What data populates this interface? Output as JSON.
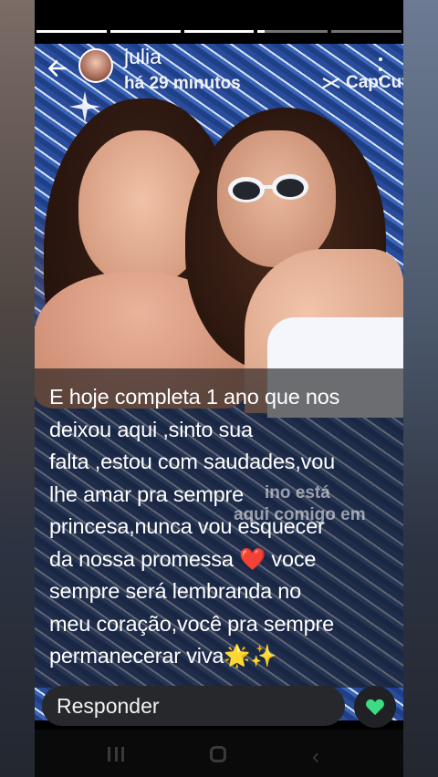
{
  "header": {
    "username": "julia",
    "timestamp": "há 29 minutos",
    "watermark": "CapCut",
    "progress_segments": [
      1,
      1,
      1,
      0.1,
      0,
      0
    ]
  },
  "story": {
    "caption_lines": [
      "E hoje completa 1 ano que nos",
      "deixou aqui ,sinto sua",
      "falta ,estou com saudades,vou",
      "lhe amar pra sempre",
      "princesa,nunca vou esquecer",
      "da nossa promessa ❤️ voce",
      "sempre será lembranda no",
      "meu coração,você pra sempre",
      "permanecerar viva🌟✨"
    ],
    "overlay_text_1": "ino está",
    "overlay_text_2": "aqui comigo em"
  },
  "footer": {
    "reply_placeholder": "Responder"
  },
  "icons": {
    "back": "arrow-left-icon",
    "menu": "more-vertical-icon",
    "like": "heart-icon",
    "capcut": "capcut-logo-icon"
  },
  "colors": {
    "like_heart": "#3ddc84",
    "reply_bg": "#26282b"
  }
}
